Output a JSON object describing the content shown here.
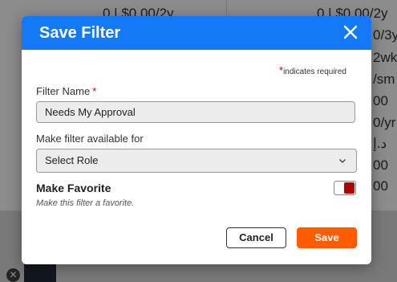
{
  "background": {
    "rows_left": [
      "0 | $0.00/2y"
    ],
    "rows_right": [
      "0 | $0.00/2y",
      "0/3y",
      "2wk",
      "/sm",
      "00",
      "0/yr",
      "د.إ",
      "00",
      "00"
    ]
  },
  "modal": {
    "title": "Save Filter",
    "required_note": "indicates required",
    "filter_name_label": "Filter Name",
    "filter_name_value": "Needs My Approval",
    "available_label": "Make filter available for",
    "available_value": "Select Role",
    "favorite_title": "Make Favorite",
    "favorite_desc": "Make this filter a favorite.",
    "favorite_on": true,
    "cancel_label": "Cancel",
    "save_label": "Save"
  },
  "colors": {
    "header": "#1479f5",
    "save_button": "#ff5c00",
    "required_star": "#d10000",
    "toggle_knob": "#b20000"
  }
}
